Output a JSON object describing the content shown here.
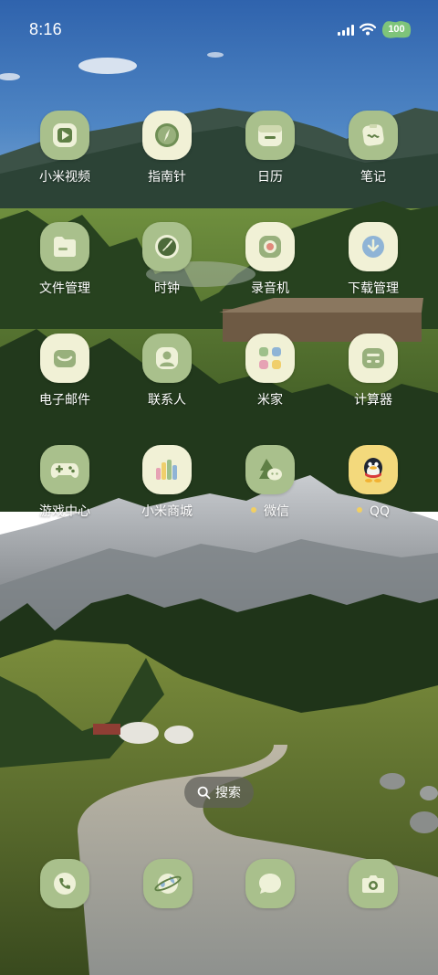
{
  "status_bar": {
    "time": "8:16",
    "battery": "100",
    "icons": [
      "signal-icon",
      "wifi-icon",
      "battery-icon"
    ]
  },
  "apps": [
    {
      "label": "小米视频",
      "icon": "video-play-icon",
      "tile": "green"
    },
    {
      "label": "指南针",
      "icon": "compass-icon",
      "tile": "cream"
    },
    {
      "label": "日历",
      "icon": "calendar-icon",
      "tile": "green"
    },
    {
      "label": "笔记",
      "icon": "notes-icon",
      "tile": "green"
    },
    {
      "label": "文件管理",
      "icon": "folder-icon",
      "tile": "green"
    },
    {
      "label": "时钟",
      "icon": "clock-icon",
      "tile": "green"
    },
    {
      "label": "录音机",
      "icon": "recorder-icon",
      "tile": "cream"
    },
    {
      "label": "下载管理",
      "icon": "download-icon",
      "tile": "cream"
    },
    {
      "label": "电子邮件",
      "icon": "mail-icon",
      "tile": "cream"
    },
    {
      "label": "联系人",
      "icon": "contacts-icon",
      "tile": "green"
    },
    {
      "label": "米家",
      "icon": "mijia-icon",
      "tile": "cream"
    },
    {
      "label": "计算器",
      "icon": "calculator-icon",
      "tile": "cream"
    },
    {
      "label": "游戏中心",
      "icon": "gamepad-icon",
      "tile": "green"
    },
    {
      "label": "小米商城",
      "icon": "mi-store-icon",
      "tile": "cream"
    },
    {
      "label": "微信",
      "icon": "wechat-icon",
      "tile": "green",
      "notification_dot": true
    },
    {
      "label": "QQ",
      "icon": "qq-penguin-icon",
      "tile": "cream",
      "notification_dot": true
    }
  ],
  "search": {
    "label": "搜索",
    "icon": "search-icon"
  },
  "dock": [
    {
      "icon": "phone-icon",
      "name": "dock-phone"
    },
    {
      "icon": "browser-icon",
      "name": "dock-browser"
    },
    {
      "icon": "messages-icon",
      "name": "dock-messages"
    },
    {
      "icon": "camera-icon",
      "name": "dock-camera"
    }
  ],
  "colors": {
    "tile_green": "#a9c08c",
    "tile_cream": "#f1f1d6",
    "icon_dark_green": "#5f7f45",
    "notification_dot": "#f2cf62",
    "battery_badge": "#7ec47a"
  }
}
